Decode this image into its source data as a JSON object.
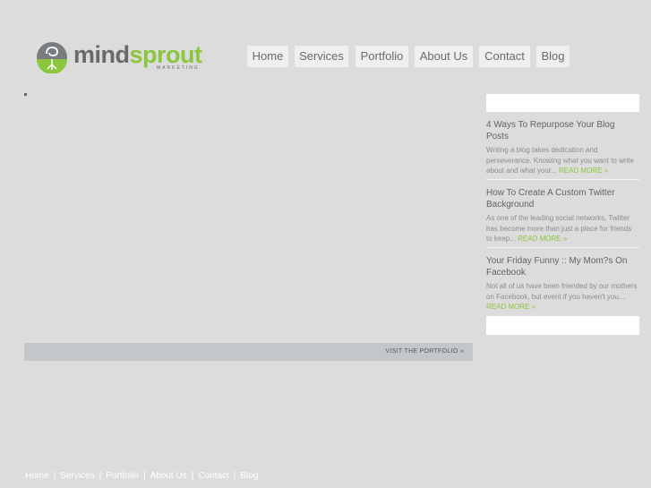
{
  "brand": {
    "name_part1": "mind",
    "name_part2": "sprout",
    "tagline": "MARKETING",
    "accent_color": "#8cc63f",
    "text_color": "#6a6a6a"
  },
  "nav": {
    "items": [
      "Home",
      "Services",
      "Portfolio",
      "About Us",
      "Contact",
      "Blog"
    ]
  },
  "main": {
    "portfolio_link": "VISIT THE PORTFOLIO »"
  },
  "sidebar": {
    "posts": [
      {
        "title": "4 Ways To Repurpose Your Blog Posts",
        "excerpt": "Writing a blog takes dedication and perseverance. Knowing what you want to write about and what your...",
        "read_more": "READ MORE »"
      },
      {
        "title": "How To Create A Custom Twitter Background",
        "excerpt": "As one of the leading social networks, Twitter has become more than just a place for friends to keep...",
        "read_more": "READ MORE »"
      },
      {
        "title": "Your Friday Funny :: My Mom?s On Facebook",
        "excerpt": "Not all of us have been friended by our mothers on Facebook, but event if you haven't you...",
        "read_more": "READ MORE »"
      }
    ]
  },
  "footer": {
    "links": [
      "Home",
      "Services",
      "Portfolio",
      "About Us",
      "Contact",
      "Blog"
    ]
  }
}
